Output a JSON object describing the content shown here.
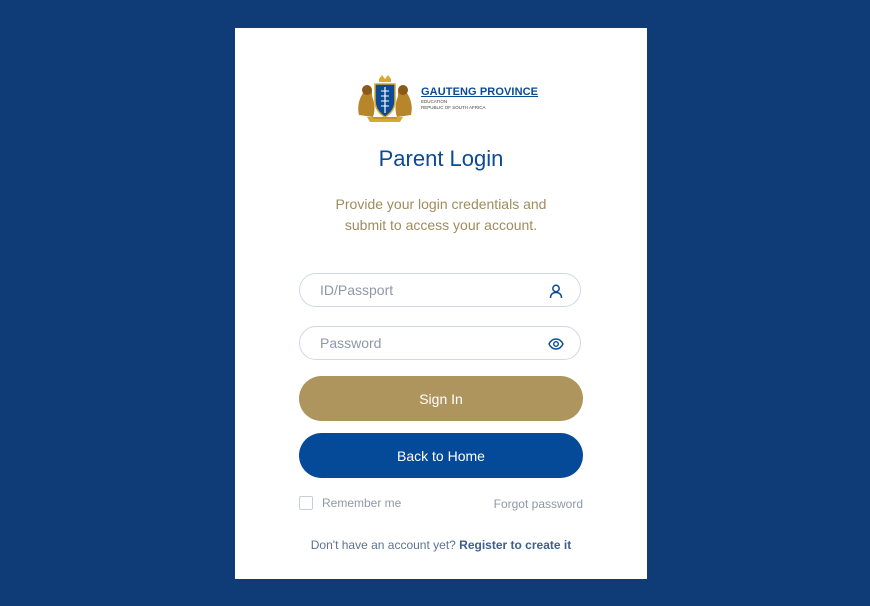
{
  "logo": {
    "title": "GAUTENG PROVINCE",
    "sub1": "EDUCATION",
    "sub2": "REPUBLIC OF SOUTH AFRICA"
  },
  "login": {
    "title": "Parent Login",
    "subtitle_line1": "Provide your login credentials and",
    "subtitle_line2": "submit to access your account."
  },
  "form": {
    "id_placeholder": "ID/Passport",
    "password_placeholder": "Password",
    "signin_label": "Sign In",
    "home_label": "Back to Home",
    "remember_label": "Remember me",
    "forgot_label": "Forgot password",
    "register_prompt": "Don't have an account yet?",
    "register_link": "Register to create it"
  },
  "colors": {
    "background": "#0f3c77",
    "primary_blue": "#054a98",
    "gold": "#ae955d",
    "muted_text": "#8e99a8"
  },
  "icons": {
    "id_field": "user-icon",
    "password_field": "eye-icon"
  }
}
